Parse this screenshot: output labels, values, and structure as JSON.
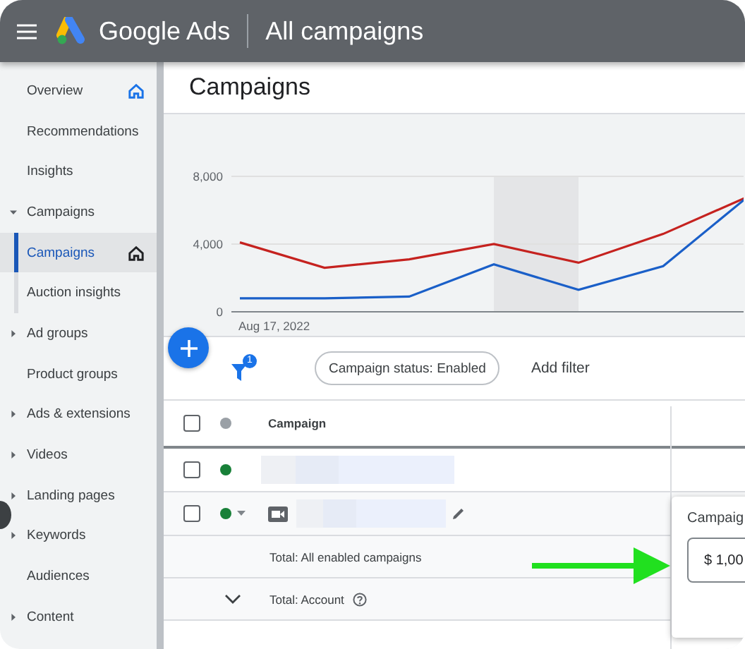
{
  "header": {
    "product": "Google Ads",
    "title": "All campaigns"
  },
  "sidebar": {
    "items": [
      {
        "label": "Overview",
        "home": true,
        "selected": false
      },
      {
        "label": "Recommendations",
        "selected": false
      },
      {
        "label": "Insights",
        "selected": false
      },
      {
        "label": "Campaigns",
        "expanded": true,
        "selected": false,
        "children": [
          {
            "label": "Campaigns",
            "home": true,
            "selected": true
          },
          {
            "label": "Auction insights",
            "selected": false
          }
        ]
      },
      {
        "label": "Ad groups",
        "expanded": false,
        "selected": false
      },
      {
        "label": "Product groups",
        "selected": false
      },
      {
        "label": "Ads & extensions",
        "expanded": false,
        "selected": false
      },
      {
        "label": "Videos",
        "expanded": false,
        "selected": false
      },
      {
        "label": "Landing pages",
        "expanded": false,
        "selected": false
      },
      {
        "label": "Keywords",
        "expanded": false,
        "selected": false
      },
      {
        "label": "Audiences",
        "selected": false
      },
      {
        "label": "Content",
        "expanded": false,
        "selected": false
      }
    ]
  },
  "page_title": "Campaigns",
  "chart": {
    "start_date": "Aug 17, 2022",
    "chart_data": {
      "type": "line",
      "ylim": [
        0,
        8000
      ],
      "yticks": [
        {
          "value": 0,
          "label": "0"
        },
        {
          "value": 4000,
          "label": "4,000"
        },
        {
          "value": 8000,
          "label": "8,000"
        }
      ],
      "series": [
        {
          "color": "#c5221f",
          "values": [
            4100,
            2600,
            3100,
            4000,
            2900,
            4600,
            6800
          ]
        },
        {
          "color": "#1a5fc8",
          "values": [
            800,
            800,
            900,
            2800,
            1300,
            2700,
            6800
          ]
        }
      ]
    }
  },
  "filter_bar": {
    "filter_count": "1",
    "chip": "Campaign status: Enabled",
    "add_filter": "Add filter"
  },
  "table": {
    "header": {
      "column": "Campaign",
      "color": "#9aa0a6",
      "checked": false
    },
    "rows": [
      {
        "kind": "campaign",
        "color": "#188038",
        "checked": false
      },
      {
        "kind": "video",
        "color": "#188038",
        "checked": false
      }
    ],
    "totals": [
      {
        "label": "Total: All enabled campaigns",
        "kind": "plain"
      },
      {
        "label": "Total: Account",
        "kind": "expandable"
      }
    ]
  },
  "budget_popup": {
    "label": "Campaig",
    "value": "$ 1,00"
  }
}
